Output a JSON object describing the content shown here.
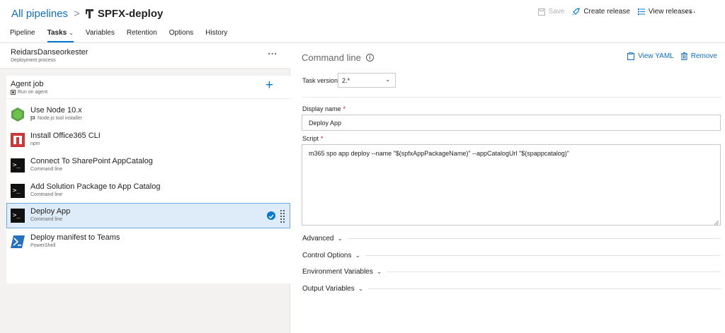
{
  "breadcrumb": {
    "root": "All pipelines",
    "separator": ">",
    "title": "SPFX-deploy"
  },
  "header_actions": {
    "save": "Save",
    "create_release": "Create release",
    "view_releases": "View releases",
    "more": "···"
  },
  "tabs": [
    {
      "label": "Pipeline"
    },
    {
      "label": "Tasks",
      "active": true
    },
    {
      "label": "Variables"
    },
    {
      "label": "Retention"
    },
    {
      "label": "Options"
    },
    {
      "label": "History"
    }
  ],
  "process": {
    "name": "ReidarsDanseorkester",
    "subtitle": "Deployment process",
    "more": "···"
  },
  "agent_job": {
    "name": "Agent job",
    "subtitle": "Run on agent",
    "add": "+"
  },
  "tasks": [
    {
      "name": "Use Node 10.x",
      "subtitle": "Node.js tool installer",
      "icon": "nodejs-icon"
    },
    {
      "name": "Install Office365 CLI",
      "subtitle": "npm",
      "icon": "npm-icon"
    },
    {
      "name": "Connect To SharePoint AppCatalog",
      "subtitle": "Command line",
      "icon": "terminal-icon"
    },
    {
      "name": "Add Solution Package to App Catalog",
      "subtitle": "Command line",
      "icon": "terminal-icon"
    },
    {
      "name": "Deploy App",
      "subtitle": "Command line",
      "icon": "terminal-icon",
      "selected": true
    },
    {
      "name": "Deploy manifest to Teams",
      "subtitle": "PowerShell",
      "icon": "powershell-icon"
    }
  ],
  "detail": {
    "title": "Command line",
    "view_yaml": "View YAML",
    "remove": "Remove",
    "task_version_label": "Task version",
    "task_version_value": "2.*",
    "display_name_label": "Display name",
    "required_mark": "*",
    "display_name_value": "Deploy App",
    "script_label": "Script",
    "script_value": "m365 spo app deploy --name \"$(spfxAppPackageName)\" --appCatalogUrl \"$(spappcatalog)\"",
    "sections": [
      "Advanced",
      "Control Options",
      "Environment Variables",
      "Output Variables"
    ]
  },
  "colors": {
    "accent": "#0078d4",
    "link": "#106ebe",
    "selected_bg": "#deecf9",
    "required": "#c50f1f"
  }
}
